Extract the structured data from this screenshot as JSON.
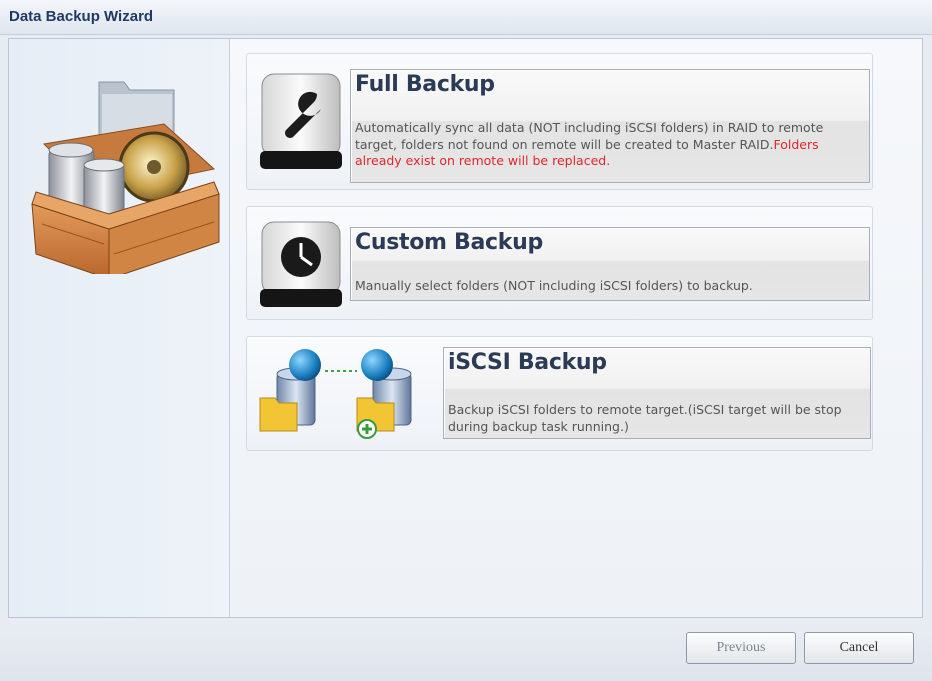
{
  "window": {
    "title": "Data Backup Wizard"
  },
  "options": [
    {
      "title": "Full Backup",
      "description": "Automatically sync all data (NOT including iSCSI folders) in RAID to remote target, folders not found on remote will be created to Master RAID.",
      "warning": "Folders already exist on remote will be replaced.",
      "icon": "wrench-drive-icon"
    },
    {
      "title": "Custom Backup",
      "description": "Manually select folders (NOT including iSCSI folders) to backup.",
      "icon": "clock-drive-icon"
    },
    {
      "title": "iSCSI Backup",
      "description": "Backup iSCSI folders to remote target.(iSCSI target will be stop during backup task running.)",
      "icon": "iscsi-transfer-icon"
    }
  ],
  "buttons": {
    "previous": "Previous",
    "cancel": "Cancel"
  },
  "colors": {
    "title_text": "#1f3b63",
    "warning_text": "#e2262b",
    "panel_border": "#a7b0ba"
  }
}
